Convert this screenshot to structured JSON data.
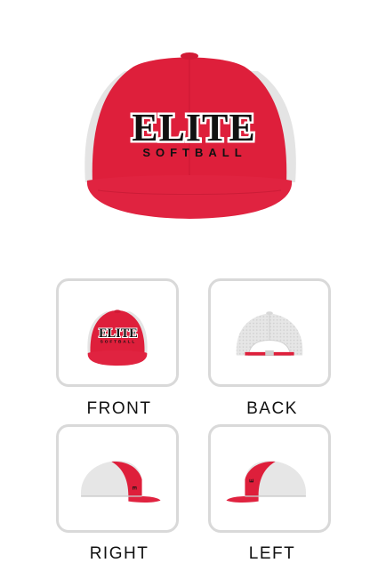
{
  "product": {
    "logo_main": "ELITE",
    "logo_sub": "SOFTBALL"
  },
  "colors": {
    "crown": "#de1f3b",
    "mesh": "#e6e6e6",
    "text": "#111111"
  },
  "views": [
    {
      "label": "FRONT",
      "icon": "cap-front-view"
    },
    {
      "label": "BACK",
      "icon": "cap-back-view"
    },
    {
      "label": "RIGHT",
      "icon": "cap-right-view"
    },
    {
      "label": "LEFT",
      "icon": "cap-left-view"
    }
  ]
}
